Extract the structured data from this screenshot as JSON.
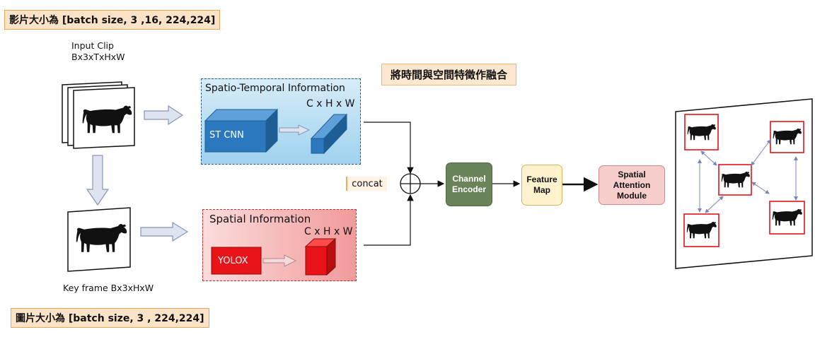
{
  "labels": {
    "video_size": "影片大小為 [batch size, 3 ,16, 224,224]",
    "image_size": "圖片大小為 [batch size, 3 , 224,224]",
    "fusion_note": "將時間與空間特徵作融合",
    "input_clip_title": "Input Clip",
    "input_clip_shape": "Bx3xTxHxW",
    "key_frame": "Key frame  Bx3xHxW",
    "concat": "concat"
  },
  "st_panel": {
    "title": "Spatio-Temporal Information",
    "block_label": "ST CNN",
    "output_shape": "C x H x W"
  },
  "sp_panel": {
    "title": "Spatial Information",
    "block_label": "YOLOX",
    "output_shape": "C x H x W"
  },
  "nodes": {
    "channel_encoder": "Channel\nEncoder",
    "feature_map": "Feature\nMap",
    "spatial_attention": "Spatial\nAttention\nModule"
  },
  "colors": {
    "st_blue": "#2b78be",
    "yolox_red": "#e8141a",
    "channel_encoder_green": "#6b8359",
    "feature_map_yellow": "#fff2cc",
    "attention_pink": "#f8cecc"
  }
}
